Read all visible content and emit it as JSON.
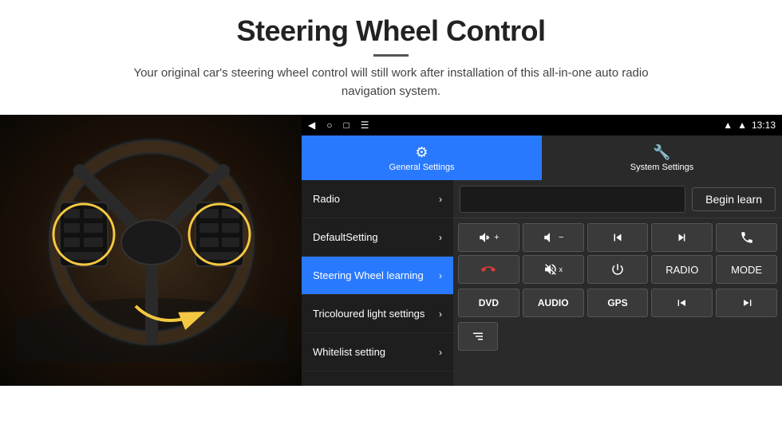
{
  "header": {
    "title": "Steering Wheel Control",
    "divider": true,
    "subtitle": "Your original car's steering wheel control will still work after installation of this all-in-one auto radio navigation system."
  },
  "status_bar": {
    "time": "13:13",
    "icons": [
      "◀",
      "○",
      "□",
      "☰"
    ]
  },
  "tabs": [
    {
      "id": "general",
      "label": "General Settings",
      "active": true
    },
    {
      "id": "system",
      "label": "System Settings",
      "active": false
    }
  ],
  "menu_items": [
    {
      "id": "radio",
      "label": "Radio",
      "active": false
    },
    {
      "id": "default",
      "label": "DefaultSetting",
      "active": false
    },
    {
      "id": "steering",
      "label": "Steering Wheel learning",
      "active": true
    },
    {
      "id": "tricoloured",
      "label": "Tricoloured light settings",
      "active": false
    },
    {
      "id": "whitelist",
      "label": "Whitelist setting",
      "active": false
    }
  ],
  "right_panel": {
    "begin_learn_label": "Begin learn",
    "control_buttons": [
      {
        "id": "vol_up",
        "symbol": "vol+",
        "type": "icon"
      },
      {
        "id": "vol_down",
        "symbol": "vol-",
        "type": "icon"
      },
      {
        "id": "prev",
        "symbol": "prev",
        "type": "icon"
      },
      {
        "id": "next",
        "symbol": "next",
        "type": "icon"
      },
      {
        "id": "phone",
        "symbol": "phone",
        "type": "icon"
      },
      {
        "id": "hangup",
        "symbol": "hangup",
        "type": "icon"
      },
      {
        "id": "mute",
        "symbol": "mute",
        "type": "icon"
      },
      {
        "id": "power",
        "symbol": "power",
        "type": "icon"
      },
      {
        "id": "radio_btn",
        "label": "RADIO",
        "type": "text"
      },
      {
        "id": "mode_btn",
        "label": "MODE",
        "type": "text"
      }
    ],
    "bottom_buttons": [
      {
        "id": "dvd",
        "label": "DVD"
      },
      {
        "id": "audio",
        "label": "AUDIO"
      },
      {
        "id": "gps",
        "label": "GPS"
      },
      {
        "id": "dvd_prev",
        "label": "⏮",
        "symbol": true
      },
      {
        "id": "dvd_next",
        "label": "⏭",
        "symbol": true
      }
    ],
    "extra_button": {
      "id": "extra",
      "label": "≡"
    }
  }
}
